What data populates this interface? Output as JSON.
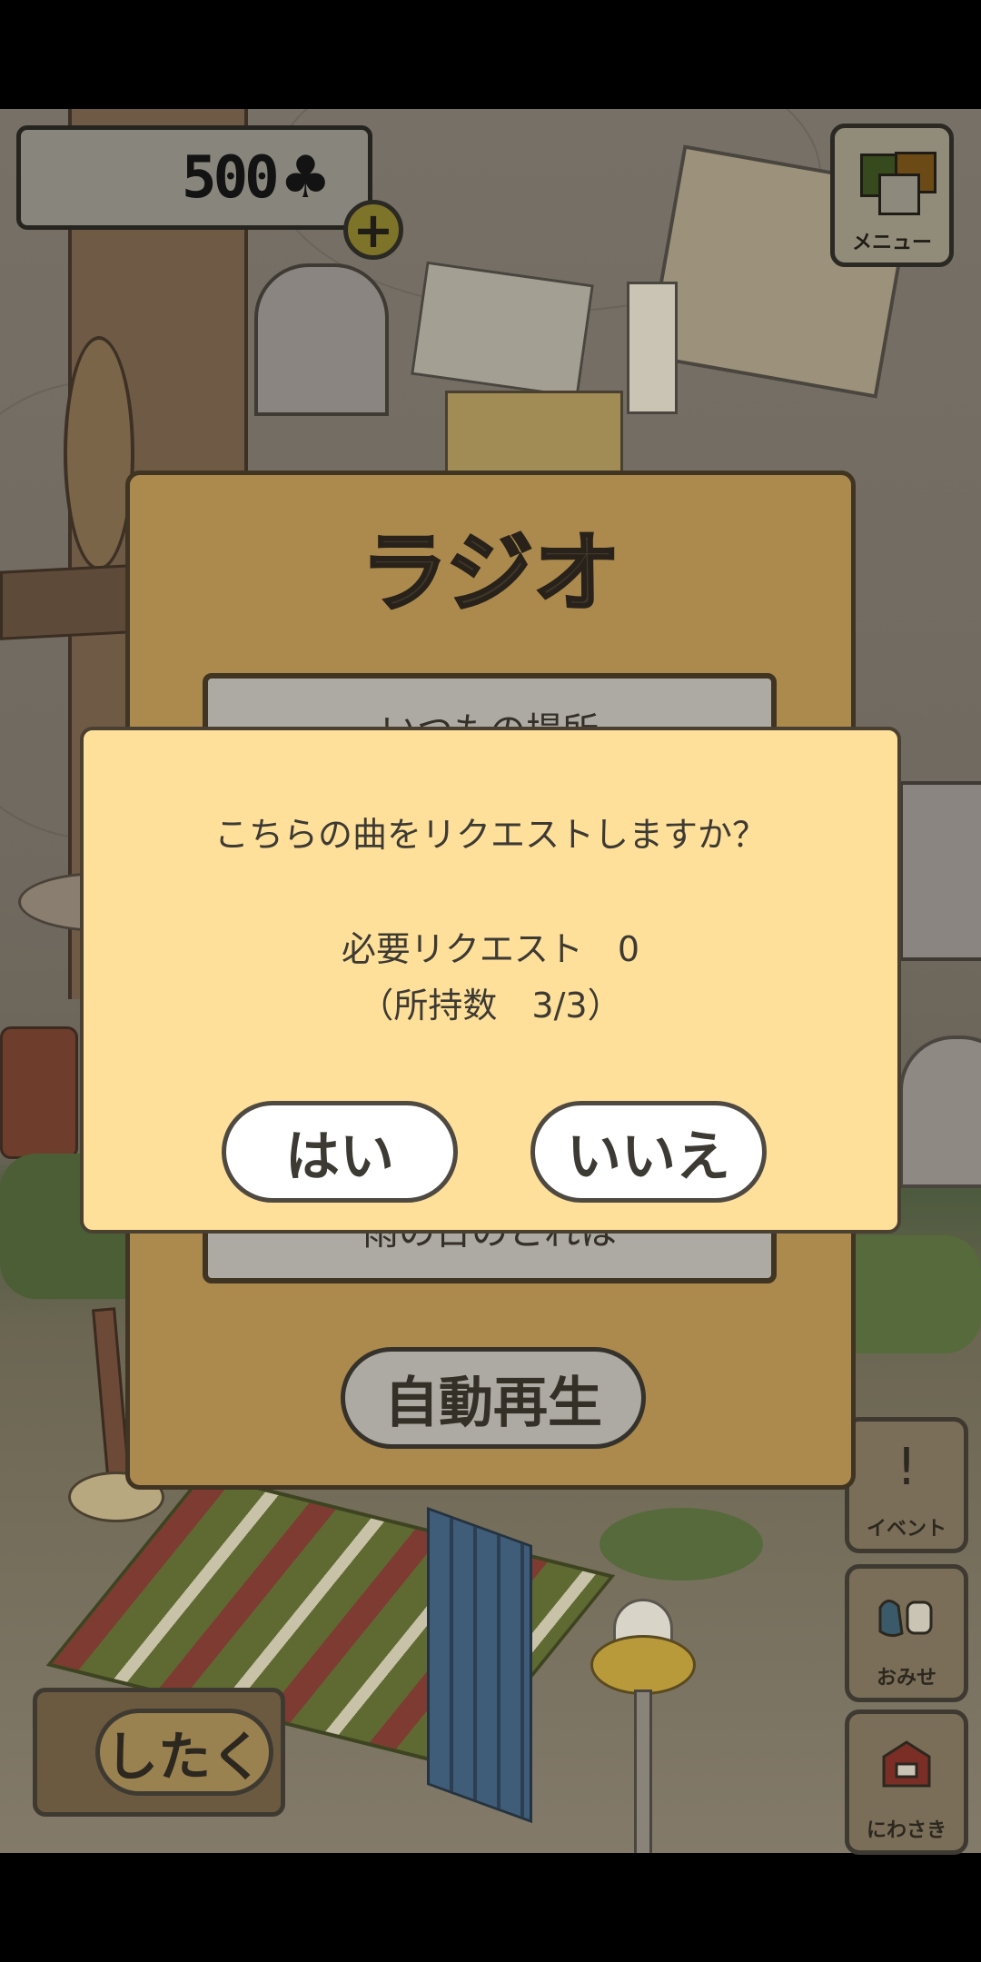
{
  "hud": {
    "coins": "500",
    "coin_symbol": "♣",
    "plus_label": "+",
    "menu_label": "メニュー",
    "event_label": "イベント",
    "event_icon": "!",
    "omise_label": "おみせ",
    "niwa_label": "にわさき",
    "shitaku_label": "したく"
  },
  "radio": {
    "title": "ラジオ",
    "song_top": "いつもの場所",
    "song_bottom": "雨の日のとれは",
    "auto_play": "自動再生"
  },
  "dialog": {
    "question": "こちらの曲をリクエストしますか？",
    "required": "必要リクエスト　0",
    "owned": "（所持数　3/3）",
    "yes": "はい",
    "no": "いいえ"
  },
  "colors": {
    "dialog_bg": "#ffe09a",
    "panel_bg": "#c8a05a",
    "letterbox": "#000000"
  }
}
